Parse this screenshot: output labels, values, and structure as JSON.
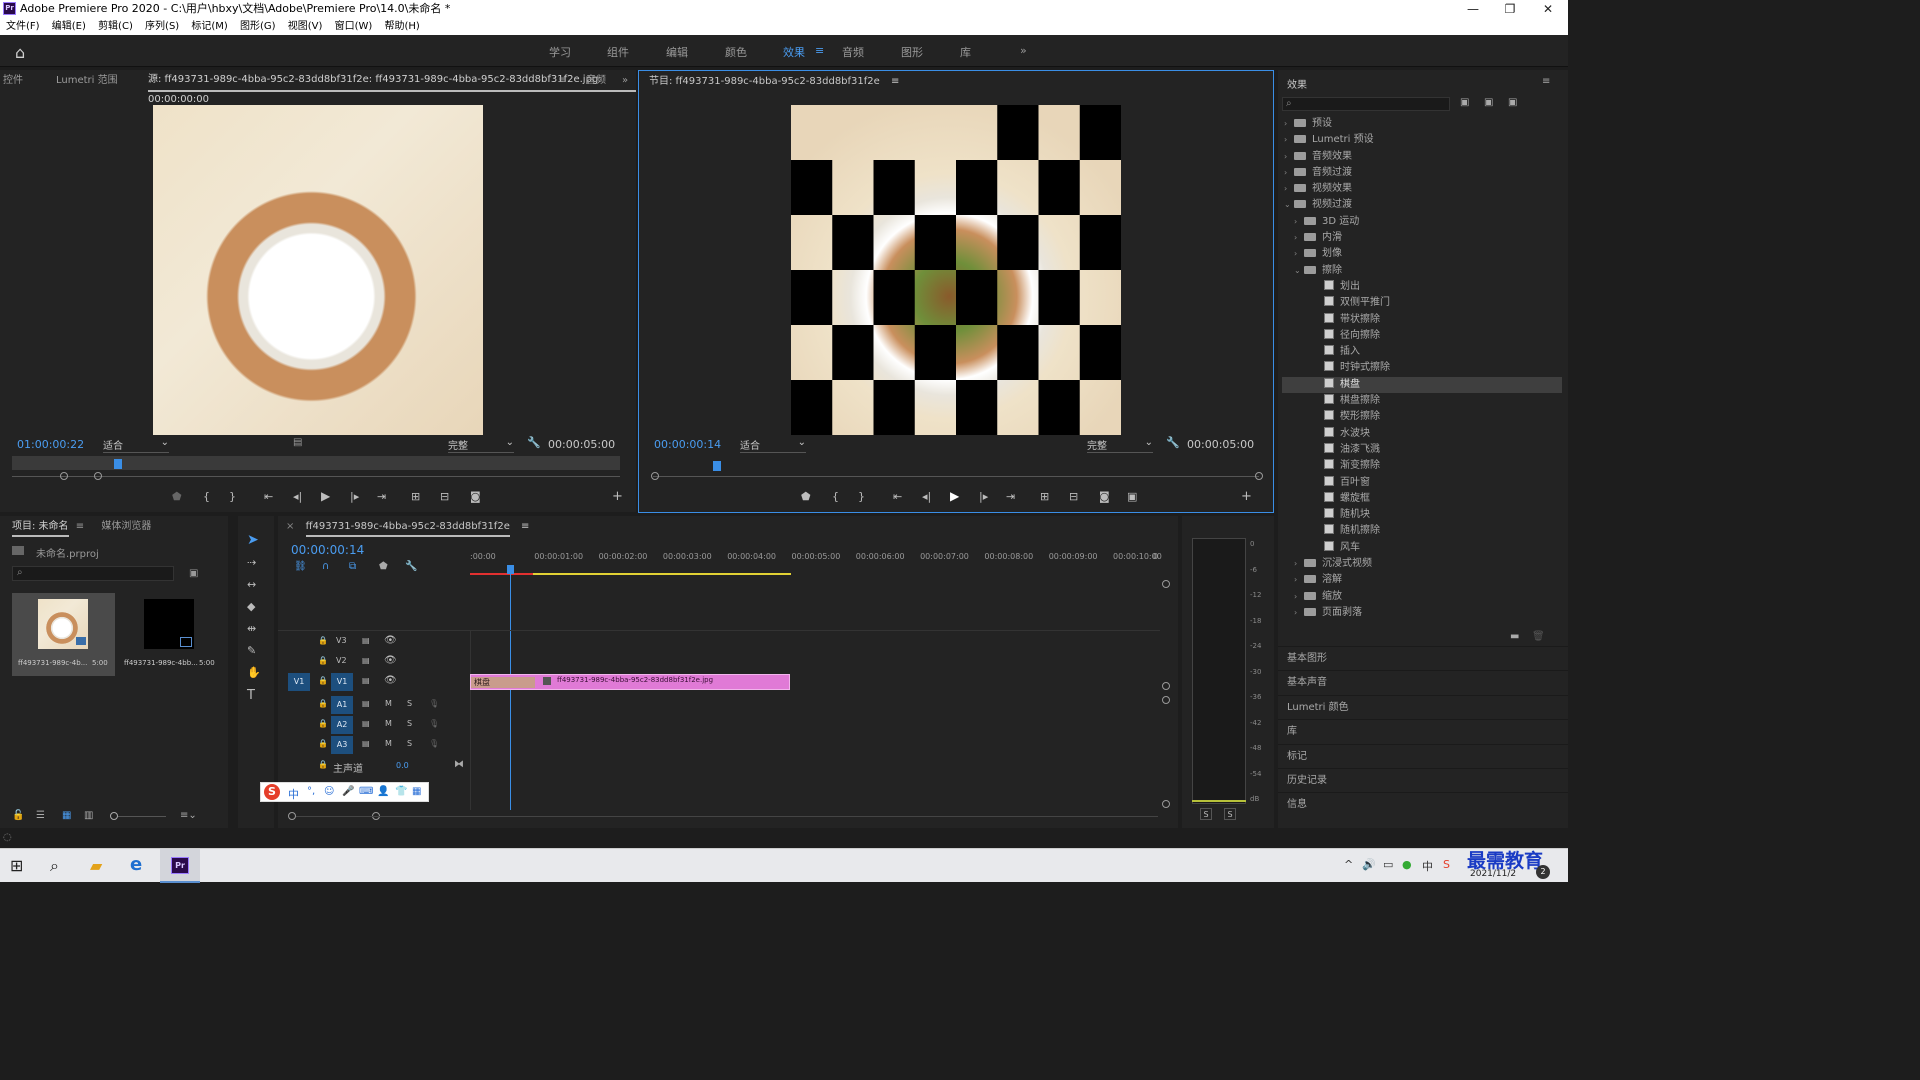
{
  "window": {
    "title": "Adobe Premiere Pro 2020 - C:\\用户\\hbxy\\文档\\Adobe\\Premiere Pro\\14.0\\未命名 *",
    "app_icon": "Pr"
  },
  "menu": [
    "文件(F)",
    "编辑(E)",
    "剪辑(C)",
    "序列(S)",
    "标记(M)",
    "图形(G)",
    "视图(V)",
    "窗口(W)",
    "帮助(H)"
  ],
  "workspaces": [
    "学习",
    "组件",
    "编辑",
    "颜色",
    "效果",
    "音频",
    "图形",
    "库"
  ],
  "active_workspace": "效果",
  "source": {
    "tabs": [
      "控件",
      "Lumetri 范围"
    ],
    "title": "源: ff493731-989c-4bba-95c2-83dd8bf31f2e: ff493731-989c-4bba-95c2-83dd8bf31f2e.jpg: 00:00:00:00",
    "extra_tab": "音频",
    "timecode": "01:00:00:22",
    "fit": "适合",
    "quality": "完整",
    "duration": "00:00:05:00"
  },
  "program": {
    "title": "节目: ff493731-989c-4bba-95c2-83dd8bf31f2e",
    "timecode": "00:00:00:14",
    "fit": "适合",
    "quality": "完整",
    "duration": "00:00:05:00"
  },
  "project": {
    "tab": "项目: 未命名",
    "tab2": "媒体浏览器",
    "file": "未命名.prproj",
    "items": [
      {
        "name": "ff493731-989c-4b...",
        "duration": "5:00"
      },
      {
        "name": "ff493731-989c-4bb...",
        "duration": "5:00"
      }
    ]
  },
  "timeline": {
    "tab": "ff493731-989c-4bba-95c2-83dd8bf31f2e",
    "timecode": "00:00:00:14",
    "ruler": [
      ":00:00",
      "00:00:01:00",
      "00:00:02:00",
      "00:00:03:00",
      "00:00:04:00",
      "00:00:05:00",
      "00:00:06:00",
      "00:00:07:00",
      "00:00:08:00",
      "00:00:09:00",
      "00:00:10:00",
      "0"
    ],
    "video_tracks": [
      "V3",
      "V2",
      "V1"
    ],
    "audio_tracks": [
      "A1",
      "A2",
      "A3"
    ],
    "master_label": "主声道",
    "master_value": "0.0",
    "clip_transition": "棋盘",
    "clip_name": "ff493731-989c-4bba-95c2-83dd8bf31f2e.jpg",
    "clip_color": "#e07ad6",
    "transition_color": "#c99c8c"
  },
  "audio_meter": {
    "scale": [
      "0",
      "-6",
      "-12",
      "-18",
      "-24",
      "-30",
      "-36",
      "-42",
      "-48",
      "-54",
      "dB"
    ],
    "solo": [
      "S",
      "S"
    ]
  },
  "effects": {
    "title": "效果",
    "tree": [
      {
        "label": "预设",
        "level": 0,
        "type": "folder",
        "state": "closed"
      },
      {
        "label": "Lumetri 预设",
        "level": 0,
        "type": "folder",
        "state": "closed"
      },
      {
        "label": "音频效果",
        "level": 0,
        "type": "folder",
        "state": "closed"
      },
      {
        "label": "音频过渡",
        "level": 0,
        "type": "folder",
        "state": "closed"
      },
      {
        "label": "视频效果",
        "level": 0,
        "type": "folder",
        "state": "closed"
      },
      {
        "label": "视频过渡",
        "level": 0,
        "type": "folder",
        "state": "open"
      },
      {
        "label": "3D 运动",
        "level": 1,
        "type": "folder",
        "state": "closed"
      },
      {
        "label": "内滑",
        "level": 1,
        "type": "folder",
        "state": "closed"
      },
      {
        "label": "划像",
        "level": 1,
        "type": "folder",
        "state": "closed"
      },
      {
        "label": "擦除",
        "level": 1,
        "type": "folder",
        "state": "open"
      },
      {
        "label": "划出",
        "level": 2,
        "type": "fx"
      },
      {
        "label": "双侧平推门",
        "level": 2,
        "type": "fx"
      },
      {
        "label": "带状擦除",
        "level": 2,
        "type": "fx"
      },
      {
        "label": "径向擦除",
        "level": 2,
        "type": "fx"
      },
      {
        "label": "插入",
        "level": 2,
        "type": "fx"
      },
      {
        "label": "时钟式擦除",
        "level": 2,
        "type": "fx"
      },
      {
        "label": "棋盘",
        "level": 2,
        "type": "fx",
        "selected": true
      },
      {
        "label": "棋盘擦除",
        "level": 2,
        "type": "fx"
      },
      {
        "label": "楔形擦除",
        "level": 2,
        "type": "fx"
      },
      {
        "label": "水波块",
        "level": 2,
        "type": "fx"
      },
      {
        "label": "油漆飞溅",
        "level": 2,
        "type": "fx"
      },
      {
        "label": "渐变擦除",
        "level": 2,
        "type": "fx"
      },
      {
        "label": "百叶窗",
        "level": 2,
        "type": "fx"
      },
      {
        "label": "螺旋框",
        "level": 2,
        "type": "fx"
      },
      {
        "label": "随机块",
        "level": 2,
        "type": "fx"
      },
      {
        "label": "随机擦除",
        "level": 2,
        "type": "fx"
      },
      {
        "label": "风车",
        "level": 2,
        "type": "fx"
      },
      {
        "label": "沉浸式视频",
        "level": 1,
        "type": "folder",
        "state": "closed"
      },
      {
        "label": "溶解",
        "level": 1,
        "type": "folder",
        "state": "closed"
      },
      {
        "label": "缩放",
        "level": 1,
        "type": "folder",
        "state": "closed"
      },
      {
        "label": "页面剥落",
        "level": 1,
        "type": "folder",
        "state": "closed"
      }
    ],
    "panels": [
      "基本图形",
      "基本声音",
      "Lumetri 颜色",
      "库",
      "标记",
      "历史记录",
      "信息"
    ]
  },
  "ime": {
    "label": "中"
  },
  "taskbar": {
    "date": "2021/11/2",
    "watermark": "最需教育",
    "badge": "2"
  }
}
